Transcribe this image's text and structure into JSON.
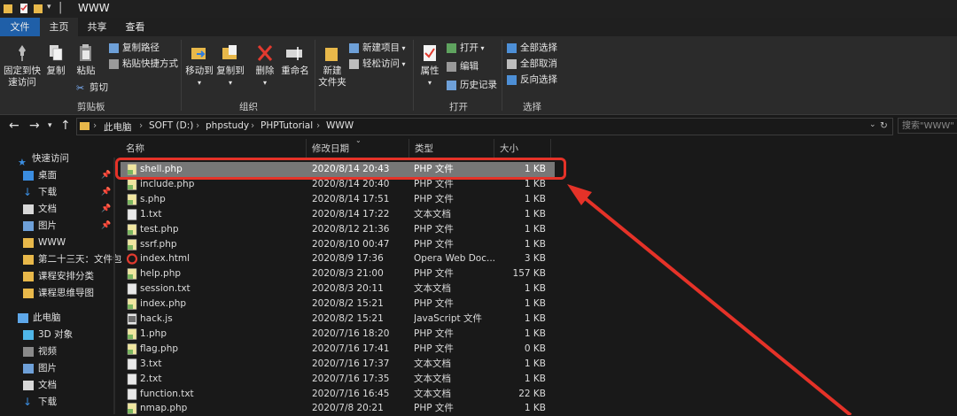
{
  "window": {
    "title": "WWW"
  },
  "menu": {
    "tabs": [
      "文件",
      "主页",
      "共享",
      "查看"
    ]
  },
  "ribbon": {
    "clipboard": {
      "pin_label_1": "固定到快",
      "pin_label_2": "速访问",
      "copy_label": "复制",
      "paste_label": "粘贴",
      "copy_path": "复制路径",
      "paste_shortcut": "粘贴快捷方式",
      "cut": "剪切",
      "group_label": "剪贴板"
    },
    "organize": {
      "move_to": "移动到",
      "copy_to": "复制到",
      "delete": "删除",
      "rename": "重命名",
      "group_label": "组织"
    },
    "new": {
      "new_folder_1": "新建",
      "new_folder_2": "文件夹",
      "new_item": "新建项目",
      "easy_access": "轻松访问"
    },
    "open": {
      "properties": "属性",
      "open": "打开",
      "edit": "编辑",
      "history": "历史记录",
      "group_label": "打开"
    },
    "select": {
      "select_all": "全部选择",
      "select_none": "全部取消",
      "invert": "反向选择",
      "group_label": "选择"
    }
  },
  "address": {
    "crumbs": [
      "此电脑",
      "SOFT (D:)",
      "phpstudy",
      "PHPTutorial",
      "WWW"
    ],
    "search_placeholder": "搜索\"WWW\""
  },
  "nav": {
    "quick_access": "快速访问",
    "items": [
      "桌面",
      "下载",
      "文档",
      "图片",
      "WWW",
      "第二十三天：文件包",
      "课程安排分类",
      "课程思维导图"
    ],
    "this_pc": "此电脑",
    "pc_items": [
      "3D 对象",
      "视频",
      "图片",
      "文档",
      "下载"
    ]
  },
  "columns": {
    "name": "名称",
    "modified": "修改日期",
    "type": "类型",
    "size": "大小"
  },
  "files": [
    {
      "name": "shell.php",
      "date": "2020/8/14 20:43",
      "type": "PHP 文件",
      "size": "1 KB",
      "kind": "php"
    },
    {
      "name": "include.php",
      "date": "2020/8/14 20:40",
      "type": "PHP 文件",
      "size": "1 KB",
      "kind": "php"
    },
    {
      "name": "s.php",
      "date": "2020/8/14 17:51",
      "type": "PHP 文件",
      "size": "1 KB",
      "kind": "php"
    },
    {
      "name": "1.txt",
      "date": "2020/8/14 17:22",
      "type": "文本文档",
      "size": "1 KB",
      "kind": "txt"
    },
    {
      "name": "test.php",
      "date": "2020/8/12 21:36",
      "type": "PHP 文件",
      "size": "1 KB",
      "kind": "php"
    },
    {
      "name": "ssrf.php",
      "date": "2020/8/10 00:47",
      "type": "PHP 文件",
      "size": "1 KB",
      "kind": "php"
    },
    {
      "name": "index.html",
      "date": "2020/8/9 17:36",
      "type": "Opera Web Doc...",
      "size": "3 KB",
      "kind": "html"
    },
    {
      "name": "help.php",
      "date": "2020/8/3 21:00",
      "type": "PHP 文件",
      "size": "157 KB",
      "kind": "php"
    },
    {
      "name": "session.txt",
      "date": "2020/8/3 20:11",
      "type": "文本文档",
      "size": "1 KB",
      "kind": "txt"
    },
    {
      "name": "index.php",
      "date": "2020/8/2 15:21",
      "type": "PHP 文件",
      "size": "1 KB",
      "kind": "php"
    },
    {
      "name": "hack.js",
      "date": "2020/8/2 15:21",
      "type": "JavaScript 文件",
      "size": "1 KB",
      "kind": "js"
    },
    {
      "name": "1.php",
      "date": "2020/7/16 18:20",
      "type": "PHP 文件",
      "size": "1 KB",
      "kind": "php"
    },
    {
      "name": "flag.php",
      "date": "2020/7/16 17:41",
      "type": "PHP 文件",
      "size": "0 KB",
      "kind": "php"
    },
    {
      "name": "3.txt",
      "date": "2020/7/16 17:37",
      "type": "文本文档",
      "size": "1 KB",
      "kind": "txt"
    },
    {
      "name": "2.txt",
      "date": "2020/7/16 17:35",
      "type": "文本文档",
      "size": "1 KB",
      "kind": "txt"
    },
    {
      "name": "function.txt",
      "date": "2020/7/16 16:45",
      "type": "文本文档",
      "size": "22 KB",
      "kind": "txt"
    },
    {
      "name": "nmap.php",
      "date": "2020/7/8 20:21",
      "type": "PHP 文件",
      "size": "1 KB",
      "kind": "php"
    }
  ],
  "colors": {
    "accent": "#1f5fa8",
    "selection": "#777777",
    "annotation": "#e53228"
  }
}
